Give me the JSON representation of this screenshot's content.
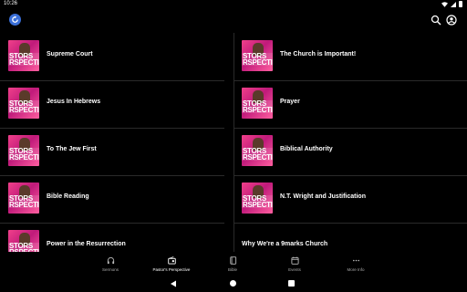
{
  "status": {
    "time": "10:26"
  },
  "app_bar": {
    "logo_icon": "app-logo-icon",
    "actions": [
      "search-icon",
      "account-circle-icon"
    ]
  },
  "thumbnail": {
    "caption": "STORS\nRSPECTI"
  },
  "sermons": [
    {
      "title": "Supreme Court"
    },
    {
      "title": "The Church is Important!"
    },
    {
      "title": "Jesus In Hebrews"
    },
    {
      "title": "Prayer"
    },
    {
      "title": "To The Jew First"
    },
    {
      "title": "Biblical Authority"
    },
    {
      "title": "Bible Reading"
    },
    {
      "title": "N.T. Wright and Justification"
    },
    {
      "title": "Power in the Resurrection"
    },
    {
      "title": "Why We're a 9marks Church"
    }
  ],
  "bottom_nav": [
    {
      "label": "Sermons",
      "icon": "headphones-icon"
    },
    {
      "label": "Pastor's Perspective",
      "icon": "radio-icon",
      "active": true
    },
    {
      "label": "Bible",
      "icon": "book-icon"
    },
    {
      "label": "Events",
      "icon": "calendar-icon"
    },
    {
      "label": "More Info",
      "icon": "more-horizontal-icon"
    }
  ],
  "colors": {
    "background": "#000000",
    "text": "#ffffff",
    "thumb_accent": "#e0307f",
    "logo": "#3a6fd8"
  }
}
